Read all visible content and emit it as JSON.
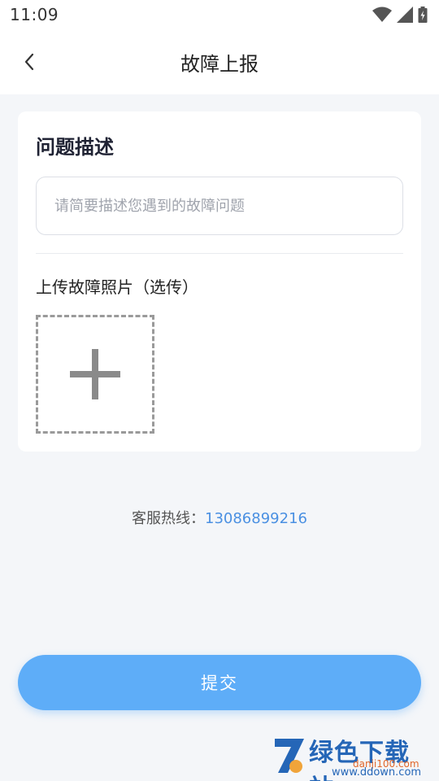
{
  "status_bar": {
    "time": "11:09"
  },
  "nav": {
    "title": "故障上报"
  },
  "form": {
    "section_title": "问题描述",
    "description_placeholder": "请简要描述您遇到的故障问题",
    "description_value": "",
    "upload_label": "上传故障照片（选传）"
  },
  "hotline": {
    "label": "客服热线：",
    "phone": "13086899216"
  },
  "submit": {
    "label": "提交"
  },
  "watermark": {
    "text": "绿色下载站",
    "url_top": "danji100.com",
    "url_bottom": "www.ddown.com"
  },
  "colors": {
    "accent": "#5eadf8",
    "phone_link": "#4a90e2",
    "background": "#f4f6f9"
  }
}
